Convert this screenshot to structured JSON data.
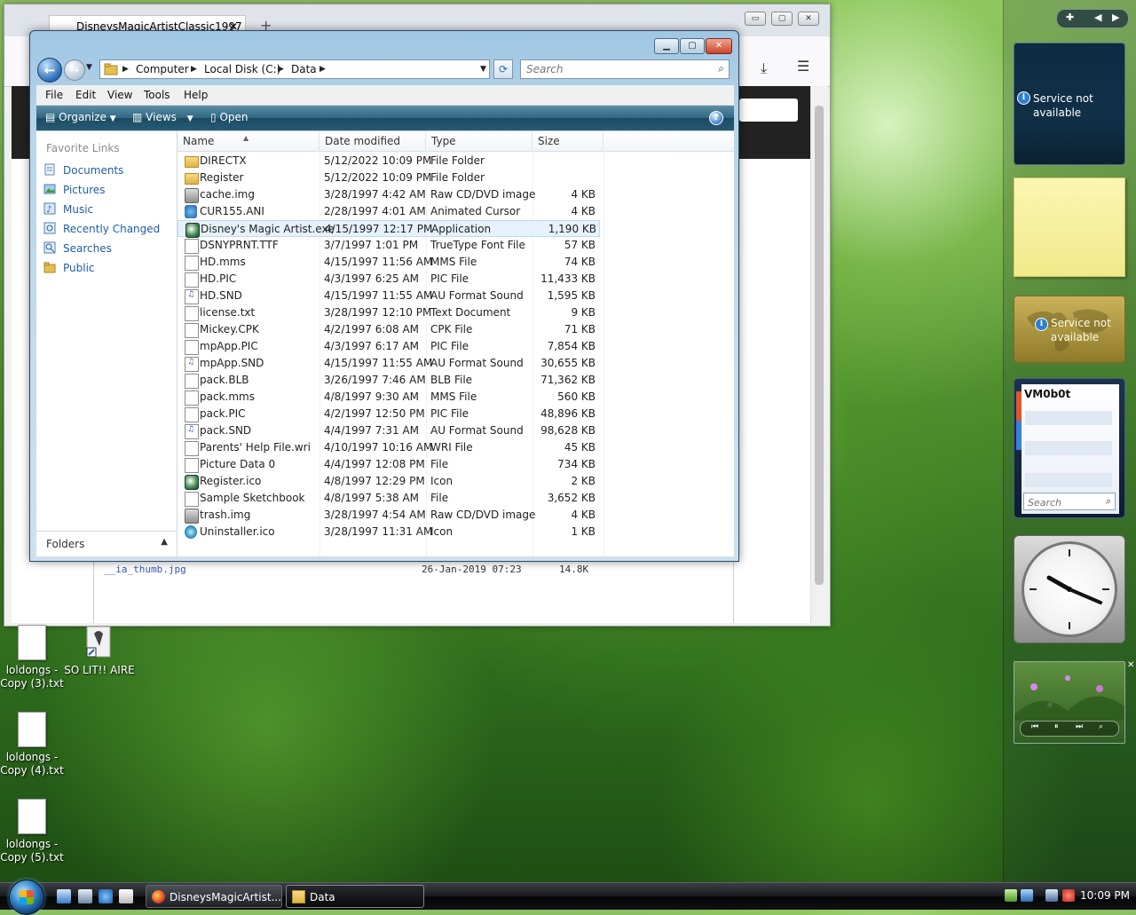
{
  "browser": {
    "tab_title": "DisneysMagicArtistClassic1997",
    "tab_close": "✕",
    "new_tab": "+",
    "min": "▭",
    "max": "▢",
    "close": "✕",
    "listing": {
      "file_name": "__ia_thumb.jpg",
      "date": "26-Jan-2019 07:23",
      "size": "14.8K"
    }
  },
  "explorer": {
    "address": [
      "Computer",
      "Local Disk (C:)",
      "Data"
    ],
    "search_placeholder": "Search",
    "menu": [
      "File",
      "Edit",
      "View",
      "Tools",
      "Help"
    ],
    "commands": {
      "organize": "Organize",
      "views": "Views",
      "open": "Open",
      "help": "?"
    },
    "favorites_header": "Favorite Links",
    "favorites": [
      "Documents",
      "Pictures",
      "Music",
      "Recently Changed",
      "Searches",
      "Public"
    ],
    "folders_label": "Folders",
    "columns": {
      "name": "Name",
      "date": "Date modified",
      "type": "Type",
      "size": "Size"
    },
    "selected_index": 4,
    "files": [
      {
        "name": "DIRECTX",
        "date": "5/12/2022 10:09 PM",
        "type": "File Folder",
        "size": "",
        "icon": "folder-icon"
      },
      {
        "name": "Register",
        "date": "5/12/2022 10:09 PM",
        "type": "File Folder",
        "size": "",
        "icon": "folder-icon"
      },
      {
        "name": "cache.img",
        "date": "3/28/1997 4:42 AM",
        "type": "Raw CD/DVD image",
        "size": "4 KB",
        "icon": "disc-image-icon"
      },
      {
        "name": "CUR155.ANI",
        "date": "2/28/1997 4:01 AM",
        "type": "Animated Cursor",
        "size": "4 KB",
        "icon": "cursor-icon"
      },
      {
        "name": "Disney's Magic Artist.exe",
        "date": "4/15/1997 12:17 PM",
        "type": "Application",
        "size": "1,190 KB",
        "icon": "application-icon"
      },
      {
        "name": "DSNYPRNT.TTF",
        "date": "3/7/1997 1:01 PM",
        "type": "TrueType Font File",
        "size": "57 KB",
        "icon": "document-icon"
      },
      {
        "name": "HD.mms",
        "date": "4/15/1997 11:56 AM",
        "type": "MMS File",
        "size": "74 KB",
        "icon": "document-icon"
      },
      {
        "name": "HD.PIC",
        "date": "4/3/1997 6:25 AM",
        "type": "PIC File",
        "size": "11,433 KB",
        "icon": "document-icon"
      },
      {
        "name": "HD.SND",
        "date": "4/15/1997 11:55 AM",
        "type": "AU Format Sound",
        "size": "1,595 KB",
        "icon": "sound-icon"
      },
      {
        "name": "license.txt",
        "date": "3/28/1997 12:10 PM",
        "type": "Text Document",
        "size": "9 KB",
        "icon": "document-icon"
      },
      {
        "name": "Mickey.CPK",
        "date": "4/2/1997 6:08 AM",
        "type": "CPK File",
        "size": "71 KB",
        "icon": "document-icon"
      },
      {
        "name": "mpApp.PIC",
        "date": "4/3/1997 6:17 AM",
        "type": "PIC File",
        "size": "7,854 KB",
        "icon": "document-icon"
      },
      {
        "name": "mpApp.SND",
        "date": "4/15/1997 11:55 AM",
        "type": "AU Format Sound",
        "size": "30,655 KB",
        "icon": "sound-icon"
      },
      {
        "name": "pack.BLB",
        "date": "3/26/1997 7:46 AM",
        "type": "BLB File",
        "size": "71,362 KB",
        "icon": "document-icon"
      },
      {
        "name": "pack.mms",
        "date": "4/8/1997 9:30 AM",
        "type": "MMS File",
        "size": "560 KB",
        "icon": "document-icon"
      },
      {
        "name": "pack.PIC",
        "date": "4/2/1997 12:50 PM",
        "type": "PIC File",
        "size": "48,896 KB",
        "icon": "document-icon"
      },
      {
        "name": "pack.SND",
        "date": "4/4/1997 7:31 AM",
        "type": "AU Format Sound",
        "size": "98,628 KB",
        "icon": "sound-icon"
      },
      {
        "name": "Parents' Help File.wri",
        "date": "4/10/1997 10:16 AM",
        "type": "WRI File",
        "size": "45 KB",
        "icon": "document-icon"
      },
      {
        "name": "Picture Data 0",
        "date": "4/4/1997 12:08 PM",
        "type": "File",
        "size": "734 KB",
        "icon": "document-icon"
      },
      {
        "name": "Register.ico",
        "date": "4/8/1997 12:29 PM",
        "type": "Icon",
        "size": "2 KB",
        "icon": "application-icon"
      },
      {
        "name": "Sample Sketchbook",
        "date": "4/8/1997 5:38 AM",
        "type": "File",
        "size": "3,652 KB",
        "icon": "document-icon"
      },
      {
        "name": "trash.img",
        "date": "3/28/1997 4:54 AM",
        "type": "Raw CD/DVD image",
        "size": "4 KB",
        "icon": "disc-image-icon"
      },
      {
        "name": "Uninstaller.ico",
        "date": "3/28/1997 11:31 AM",
        "type": "Icon",
        "size": "1 KB",
        "icon": "uninstaller-icon"
      }
    ]
  },
  "gadgets": {
    "service_not_available_1": "Service not available",
    "service_not_available_2": "Service not available",
    "feed_title": "VM0b0t",
    "feed_search_placeholder": "Search"
  },
  "desktop_icons": [
    {
      "label": "loldongs - Copy (3).txt"
    },
    {
      "label": "SO LIT!! AIRE"
    },
    {
      "label": "loldongs - Copy (4).txt"
    },
    {
      "label": "loldongs - Copy (5).txt"
    }
  ],
  "taskbar": {
    "tasks": [
      "DisneysMagicArtist...",
      "Data"
    ],
    "clock": "10:09 PM"
  },
  "colors": {
    "command_bar": "#2f6681",
    "link_blue": "#1f5ea8",
    "selection": "#e6f1fb"
  }
}
